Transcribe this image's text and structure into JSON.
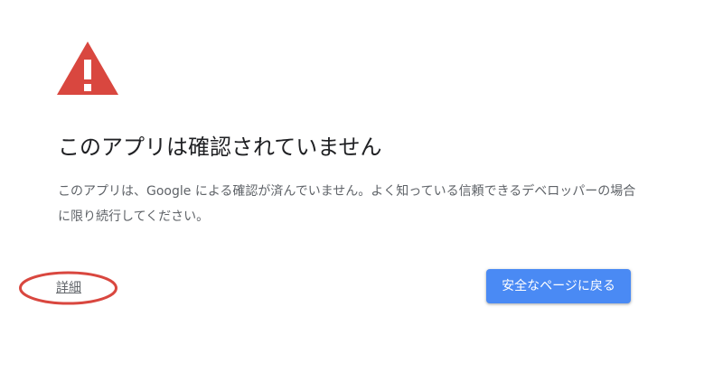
{
  "interstitial": {
    "icon": "warning-triangle-icon",
    "title": "このアプリは確認されていません",
    "message": "このアプリは、Google による確認が済んでいません。よく知っている信頼できるデベロッパーの場合に限り続行してください。",
    "details_link": "詳細",
    "back_button": "安全なページに戻る"
  },
  "colors": {
    "warning_red": "#d9473f",
    "button_blue": "#4a8af4",
    "annotation_red": "#d9473f",
    "title_text": "#202124",
    "body_text": "#5f6368"
  }
}
